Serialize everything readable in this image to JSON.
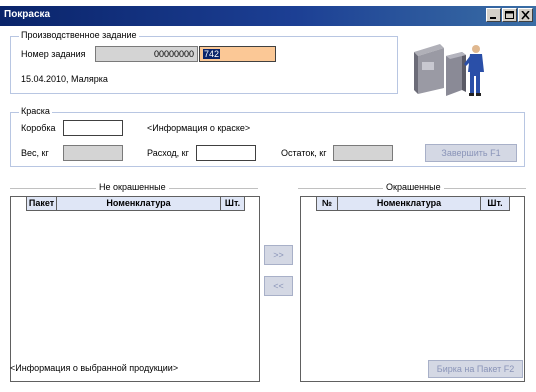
{
  "window": {
    "title": "Покраска"
  },
  "task": {
    "legend": "Производственное задание",
    "number_label": "Номер задания",
    "number_prefix": "00000000",
    "number_value": "742",
    "date_line": "15.04.2010, Малярка"
  },
  "paint": {
    "legend": "Краска",
    "box_label": "Коробка",
    "box_value": "",
    "info": "<Информация о краске>",
    "weight_label": "Вес, кг",
    "weight_value": "",
    "usage_label": "Расход, кг",
    "usage_value": "",
    "rest_label": "Остаток, кг",
    "rest_value": "",
    "finish_button": "Завершить    F1"
  },
  "unpainted": {
    "title": "Не окрашенные",
    "columns": [
      "",
      "Пакет",
      "Номенклатура",
      "Шт."
    ]
  },
  "painted": {
    "title": "Окрашенные",
    "columns": [
      "",
      "№",
      "Номенклатура",
      "Шт."
    ]
  },
  "transfer": {
    "right": ">>",
    "left": "<<"
  },
  "footer": {
    "info": "<Информация о выбранной продукции>",
    "tag_button": "Бирка на Пакет   F2"
  },
  "colors": {
    "titlebar": "#0a246a",
    "group_border": "#b8c6e2",
    "accent_field": "#fbc896",
    "grid_header": "#dfe6f6"
  },
  "icons": [
    "minimize-icon",
    "maximize-icon",
    "close-icon",
    "worker-illustration"
  ]
}
